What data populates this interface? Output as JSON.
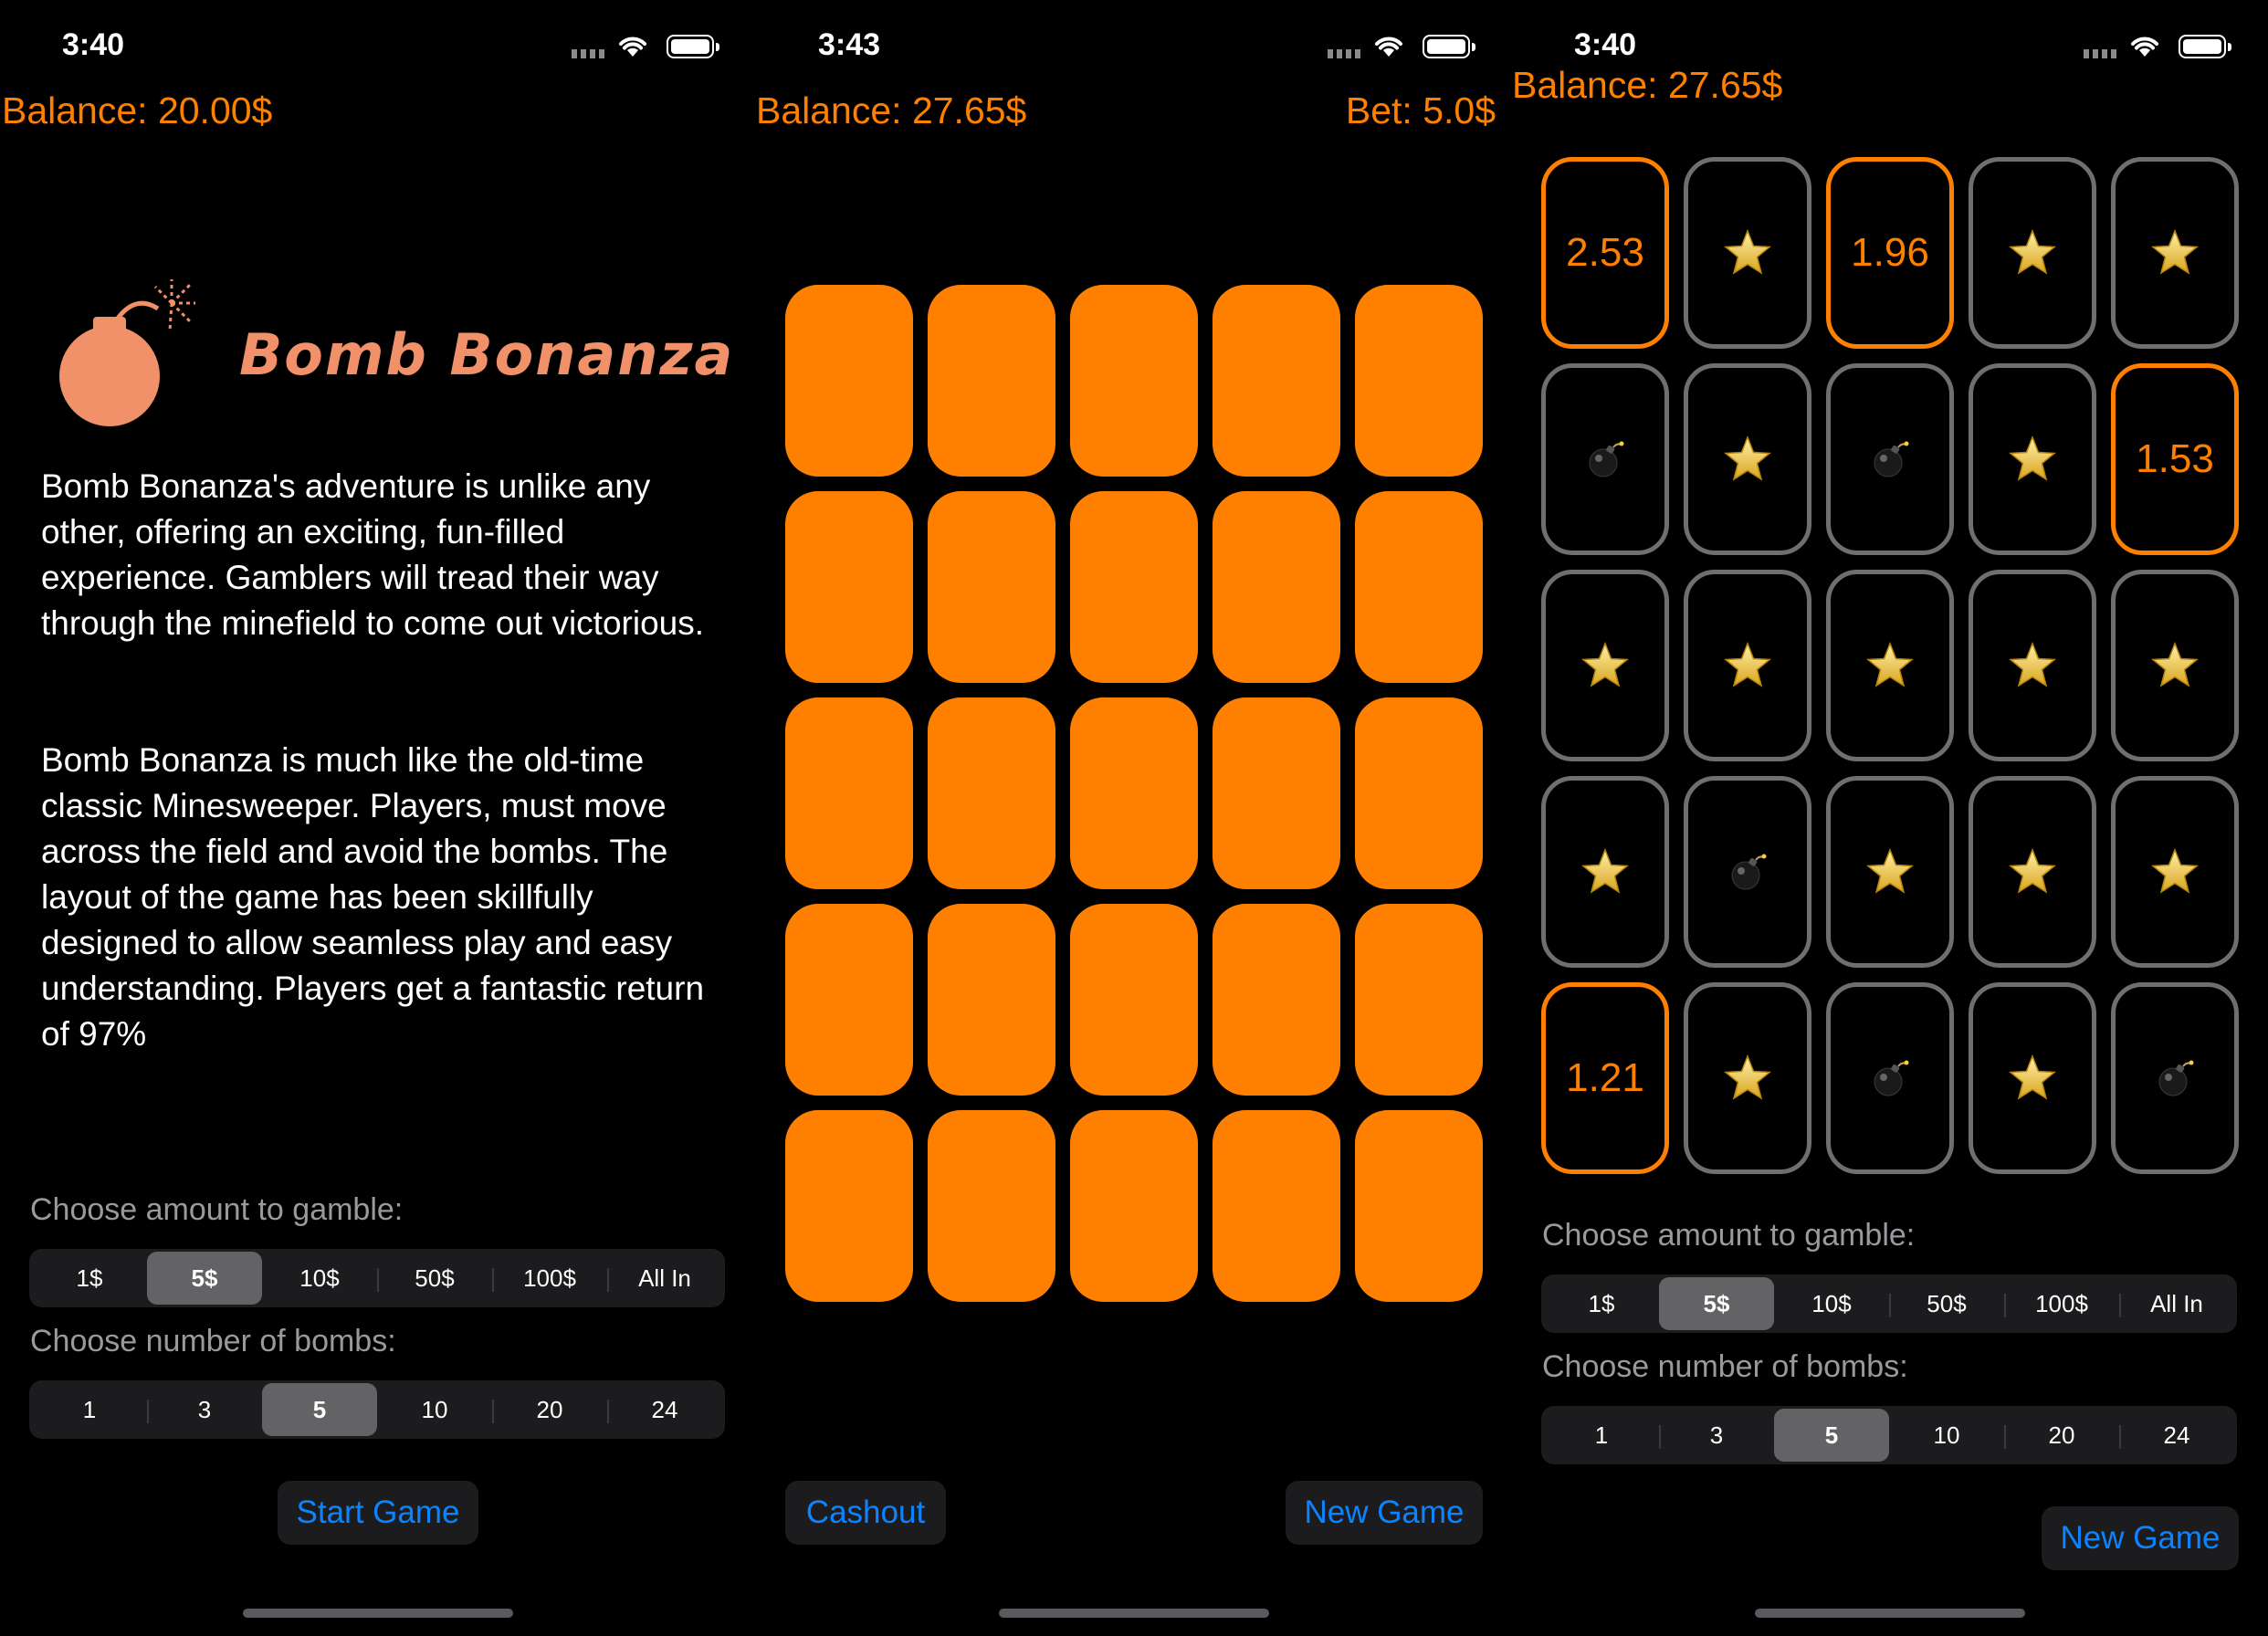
{
  "colors": {
    "accent": "#ff8000",
    "link": "#0a84ff",
    "logo": "#f0916a",
    "tile_border": "#6e6e73"
  },
  "screen1": {
    "status_time": "3:40",
    "balance": "Balance: 20.00$",
    "logo_text": "Bomb Bonanza",
    "paragraph1": "Bomb Bonanza's adventure is unlike any other, offering an exciting, fun-filled experience. Gamblers will tread their way through the minefield to come out victorious.",
    "paragraph2": "Bomb Bonanza is much like the old-time classic Minesweeper. Players, must move across the field and avoid the bombs. The layout of the game has been skillfully designed to allow seamless play and easy understanding. Players get a fantastic return of 97%",
    "amount_label": "Choose amount to gamble:",
    "amount_options": [
      "1$",
      "5$",
      "10$",
      "50$",
      "100$",
      "All In"
    ],
    "amount_selected": "5$",
    "bombs_label": "Choose number of bombs:",
    "bombs_options": [
      "1",
      "3",
      "5",
      "10",
      "20",
      "24"
    ],
    "bombs_selected": "5",
    "start_button": "Start Game"
  },
  "screen2": {
    "status_time": "3:43",
    "balance": "Balance: 27.65$",
    "bet": "Bet: 5.0$",
    "cashout_button": "Cashout",
    "new_game_button": "New Game"
  },
  "screen3": {
    "status_time": "3:40",
    "balance": "Balance: 27.65$",
    "grid": [
      [
        {
          "type": "win",
          "value": "2.53"
        },
        {
          "type": "star"
        },
        {
          "type": "win",
          "value": "1.96"
        },
        {
          "type": "star"
        },
        {
          "type": "star"
        }
      ],
      [
        {
          "type": "bomb"
        },
        {
          "type": "star"
        },
        {
          "type": "bomb"
        },
        {
          "type": "star"
        },
        {
          "type": "win",
          "value": "1.53"
        }
      ],
      [
        {
          "type": "star"
        },
        {
          "type": "star"
        },
        {
          "type": "star"
        },
        {
          "type": "star"
        },
        {
          "type": "star"
        }
      ],
      [
        {
          "type": "star"
        },
        {
          "type": "bomb"
        },
        {
          "type": "star"
        },
        {
          "type": "star"
        },
        {
          "type": "star"
        }
      ],
      [
        {
          "type": "win",
          "value": "1.21"
        },
        {
          "type": "star"
        },
        {
          "type": "bomb"
        },
        {
          "type": "star"
        },
        {
          "type": "bomb"
        }
      ]
    ],
    "amount_label": "Choose amount to gamble:",
    "amount_options": [
      "1$",
      "5$",
      "10$",
      "50$",
      "100$",
      "All In"
    ],
    "amount_selected": "5$",
    "bombs_label": "Choose number of bombs:",
    "bombs_options": [
      "1",
      "3",
      "5",
      "10",
      "20",
      "24"
    ],
    "bombs_selected": "5",
    "new_game_button": "New Game"
  }
}
